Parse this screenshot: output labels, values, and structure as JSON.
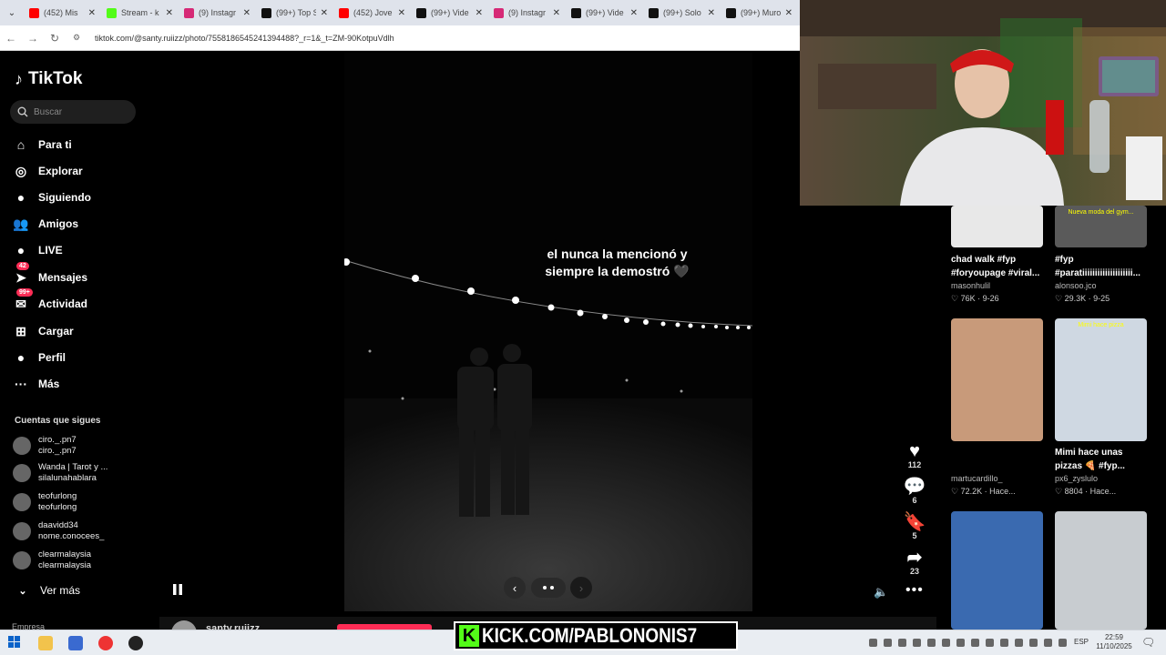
{
  "browser": {
    "tabs": [
      {
        "label": "(452) Mis",
        "color": "#ff0000"
      },
      {
        "label": "Stream - k",
        "color": "#53fc18"
      },
      {
        "label": "(9) Instagr",
        "color": "#d62976"
      },
      {
        "label": "(99+) Top S",
        "color": "#111111"
      },
      {
        "label": "(452) Jove",
        "color": "#ff0000"
      },
      {
        "label": "(99+) Vide",
        "color": "#111111"
      },
      {
        "label": "(9) Instagr",
        "color": "#d62976"
      },
      {
        "label": "(99+) Vide",
        "color": "#111111"
      },
      {
        "label": "(99+) Solo",
        "color": "#111111"
      },
      {
        "label": "(99+) Muro",
        "color": "#111111"
      }
    ],
    "url": "tiktok.com/@santy.ruiizz/photo/7558186545241394488?_r=1&_t=ZM-90KotpuVdlh"
  },
  "tiktok": {
    "logo": "TikTok",
    "search_placeholder": "Buscar",
    "nav": [
      {
        "label": "Para ti",
        "icon": "home-icon"
      },
      {
        "label": "Explorar",
        "icon": "compass-icon"
      },
      {
        "label": "Siguiendo",
        "icon": "following-icon"
      },
      {
        "label": "Amigos",
        "icon": "friends-icon"
      },
      {
        "label": "LIVE",
        "icon": "live-icon"
      },
      {
        "label": "Mensajes",
        "icon": "messages-icon",
        "badge": "42"
      },
      {
        "label": "Actividad",
        "icon": "activity-icon",
        "badge": "99+"
      },
      {
        "label": "Cargar",
        "icon": "upload-icon"
      },
      {
        "label": "Perfil",
        "icon": "profile-icon"
      },
      {
        "label": "Más",
        "icon": "more-icon"
      }
    ],
    "following_title": "Cuentas que sigues",
    "following": [
      {
        "name": "ciro._.pn7",
        "handle": "ciro._.pn7"
      },
      {
        "name": "Wanda | Tarot y ...",
        "handle": "silalunahablara"
      },
      {
        "name": "teofurlong",
        "handle": "teofurlong"
      },
      {
        "name": "daavidd34",
        "handle": "nome.conocees_"
      },
      {
        "name": "clearmalaysia",
        "handle": "clearmalaysia"
      }
    ],
    "see_more": "Ver más",
    "company": "Empresa",
    "author": "santy.ruiizz",
    "caption_line1": "el nunca la mencionó y",
    "caption_line2": "siempre la demostró 🖤",
    "actions": {
      "likes": "112",
      "comments": "6",
      "saves": "5",
      "shares": "23"
    }
  },
  "related": [
    {
      "title_line1": "chad walk #fyp",
      "title_line2": "#foryoupage #viral...",
      "user": "masonhulil",
      "stats": "76K · 9-26"
    },
    {
      "title_line1": "#fyp",
      "title_line2": "#paratiiiiiiiiiiiiiiiiiiii...",
      "user": "alonsoo.jco",
      "stats": "29.3K · 9-25",
      "thumb_text": "Nueva moda del gym..."
    },
    {
      "title_line1": "",
      "title_line2": "",
      "user": "martucardillo_",
      "stats": "72.2K · Hace..."
    },
    {
      "title_line1": "Mimi hace unas",
      "title_line2": "pizzas 🍕 #fyp...",
      "user": "px6_zyslulo",
      "stats": "8804 · Hace...",
      "thumb_text": "Mimi hace pizza"
    },
    {
      "title_line1": "",
      "title_line2": "",
      "user": "",
      "stats": ""
    },
    {
      "title_line1": "",
      "title_line2": "",
      "user": "",
      "stats": ""
    }
  ],
  "overlay": {
    "kick_text": "KICK.COM/PABLONONIS7"
  },
  "taskbar": {
    "lang": "ESP",
    "time": "22:59",
    "date": "11/10/2025"
  }
}
